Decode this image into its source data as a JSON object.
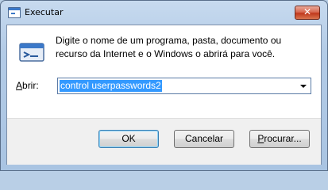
{
  "window": {
    "title": "Executar",
    "close_glyph": "✕"
  },
  "dialog": {
    "description": "Digite o nome de um programa, pasta, documento ou recurso da Internet e o Windows o abrirá para você.",
    "open_label_prefix": "A",
    "open_label_rest": "brir:",
    "combo_value": "control userpasswords2"
  },
  "buttons": {
    "ok": "OK",
    "cancel": "Cancelar",
    "browse_prefix": "P",
    "browse_rest": "rocurar..."
  },
  "icons": {
    "title": "run-window-icon",
    "main": "run-program-icon",
    "dropdown": "chevron-down-icon"
  }
}
